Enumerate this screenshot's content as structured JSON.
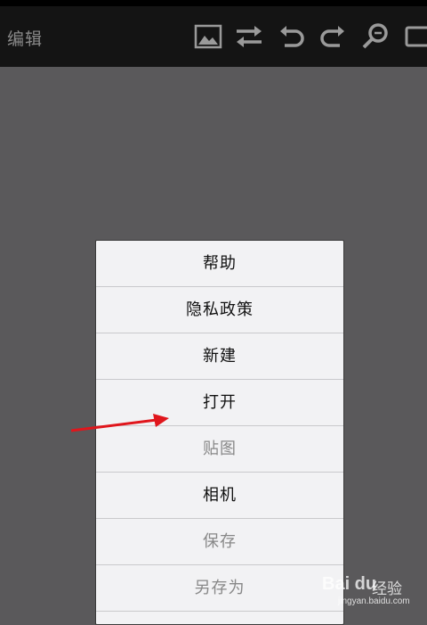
{
  "toolbar": {
    "title": "编辑",
    "icons": [
      "image-icon",
      "swap-icon",
      "undo-icon",
      "redo-icon",
      "zoom-icon",
      "rectangle-icon"
    ]
  },
  "menu": {
    "items": [
      {
        "label": "帮助",
        "enabled": true
      },
      {
        "label": "隐私政策",
        "enabled": true
      },
      {
        "label": "新建",
        "enabled": true
      },
      {
        "label": "打开",
        "enabled": true
      },
      {
        "label": "贴图",
        "enabled": false
      },
      {
        "label": "相机",
        "enabled": true
      },
      {
        "label": "保存",
        "enabled": false
      },
      {
        "label": "另存为",
        "enabled": false
      }
    ]
  },
  "watermark": {
    "logo": "Bai du",
    "jingyan": "经验",
    "url": "jingyan.baidu.com"
  },
  "colors": {
    "canvas": "#5a595b",
    "toolbar": "#141414",
    "menu_bg": "#f2f2f4",
    "arrow": "#e0161c"
  }
}
